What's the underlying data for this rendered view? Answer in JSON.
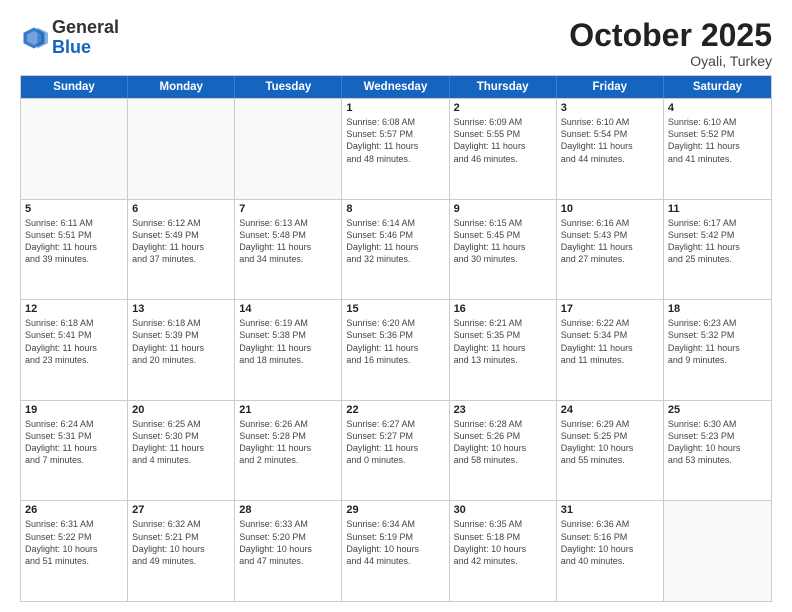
{
  "logo": {
    "general": "General",
    "blue": "Blue"
  },
  "header": {
    "month": "October 2025",
    "location": "Oyali, Turkey"
  },
  "weekdays": [
    "Sunday",
    "Monday",
    "Tuesday",
    "Wednesday",
    "Thursday",
    "Friday",
    "Saturday"
  ],
  "weeks": [
    [
      {
        "day": "",
        "info": "",
        "empty": true
      },
      {
        "day": "",
        "info": "",
        "empty": true
      },
      {
        "day": "",
        "info": "",
        "empty": true
      },
      {
        "day": "1",
        "info": "Sunrise: 6:08 AM\nSunset: 5:57 PM\nDaylight: 11 hours\nand 48 minutes."
      },
      {
        "day": "2",
        "info": "Sunrise: 6:09 AM\nSunset: 5:55 PM\nDaylight: 11 hours\nand 46 minutes."
      },
      {
        "day": "3",
        "info": "Sunrise: 6:10 AM\nSunset: 5:54 PM\nDaylight: 11 hours\nand 44 minutes."
      },
      {
        "day": "4",
        "info": "Sunrise: 6:10 AM\nSunset: 5:52 PM\nDaylight: 11 hours\nand 41 minutes."
      }
    ],
    [
      {
        "day": "5",
        "info": "Sunrise: 6:11 AM\nSunset: 5:51 PM\nDaylight: 11 hours\nand 39 minutes."
      },
      {
        "day": "6",
        "info": "Sunrise: 6:12 AM\nSunset: 5:49 PM\nDaylight: 11 hours\nand 37 minutes."
      },
      {
        "day": "7",
        "info": "Sunrise: 6:13 AM\nSunset: 5:48 PM\nDaylight: 11 hours\nand 34 minutes."
      },
      {
        "day": "8",
        "info": "Sunrise: 6:14 AM\nSunset: 5:46 PM\nDaylight: 11 hours\nand 32 minutes."
      },
      {
        "day": "9",
        "info": "Sunrise: 6:15 AM\nSunset: 5:45 PM\nDaylight: 11 hours\nand 30 minutes."
      },
      {
        "day": "10",
        "info": "Sunrise: 6:16 AM\nSunset: 5:43 PM\nDaylight: 11 hours\nand 27 minutes."
      },
      {
        "day": "11",
        "info": "Sunrise: 6:17 AM\nSunset: 5:42 PM\nDaylight: 11 hours\nand 25 minutes."
      }
    ],
    [
      {
        "day": "12",
        "info": "Sunrise: 6:18 AM\nSunset: 5:41 PM\nDaylight: 11 hours\nand 23 minutes."
      },
      {
        "day": "13",
        "info": "Sunrise: 6:18 AM\nSunset: 5:39 PM\nDaylight: 11 hours\nand 20 minutes."
      },
      {
        "day": "14",
        "info": "Sunrise: 6:19 AM\nSunset: 5:38 PM\nDaylight: 11 hours\nand 18 minutes."
      },
      {
        "day": "15",
        "info": "Sunrise: 6:20 AM\nSunset: 5:36 PM\nDaylight: 11 hours\nand 16 minutes."
      },
      {
        "day": "16",
        "info": "Sunrise: 6:21 AM\nSunset: 5:35 PM\nDaylight: 11 hours\nand 13 minutes."
      },
      {
        "day": "17",
        "info": "Sunrise: 6:22 AM\nSunset: 5:34 PM\nDaylight: 11 hours\nand 11 minutes."
      },
      {
        "day": "18",
        "info": "Sunrise: 6:23 AM\nSunset: 5:32 PM\nDaylight: 11 hours\nand 9 minutes."
      }
    ],
    [
      {
        "day": "19",
        "info": "Sunrise: 6:24 AM\nSunset: 5:31 PM\nDaylight: 11 hours\nand 7 minutes."
      },
      {
        "day": "20",
        "info": "Sunrise: 6:25 AM\nSunset: 5:30 PM\nDaylight: 11 hours\nand 4 minutes."
      },
      {
        "day": "21",
        "info": "Sunrise: 6:26 AM\nSunset: 5:28 PM\nDaylight: 11 hours\nand 2 minutes."
      },
      {
        "day": "22",
        "info": "Sunrise: 6:27 AM\nSunset: 5:27 PM\nDaylight: 11 hours\nand 0 minutes."
      },
      {
        "day": "23",
        "info": "Sunrise: 6:28 AM\nSunset: 5:26 PM\nDaylight: 10 hours\nand 58 minutes."
      },
      {
        "day": "24",
        "info": "Sunrise: 6:29 AM\nSunset: 5:25 PM\nDaylight: 10 hours\nand 55 minutes."
      },
      {
        "day": "25",
        "info": "Sunrise: 6:30 AM\nSunset: 5:23 PM\nDaylight: 10 hours\nand 53 minutes."
      }
    ],
    [
      {
        "day": "26",
        "info": "Sunrise: 6:31 AM\nSunset: 5:22 PM\nDaylight: 10 hours\nand 51 minutes."
      },
      {
        "day": "27",
        "info": "Sunrise: 6:32 AM\nSunset: 5:21 PM\nDaylight: 10 hours\nand 49 minutes."
      },
      {
        "day": "28",
        "info": "Sunrise: 6:33 AM\nSunset: 5:20 PM\nDaylight: 10 hours\nand 47 minutes."
      },
      {
        "day": "29",
        "info": "Sunrise: 6:34 AM\nSunset: 5:19 PM\nDaylight: 10 hours\nand 44 minutes."
      },
      {
        "day": "30",
        "info": "Sunrise: 6:35 AM\nSunset: 5:18 PM\nDaylight: 10 hours\nand 42 minutes."
      },
      {
        "day": "31",
        "info": "Sunrise: 6:36 AM\nSunset: 5:16 PM\nDaylight: 10 hours\nand 40 minutes."
      },
      {
        "day": "",
        "info": "",
        "empty": true
      }
    ]
  ]
}
